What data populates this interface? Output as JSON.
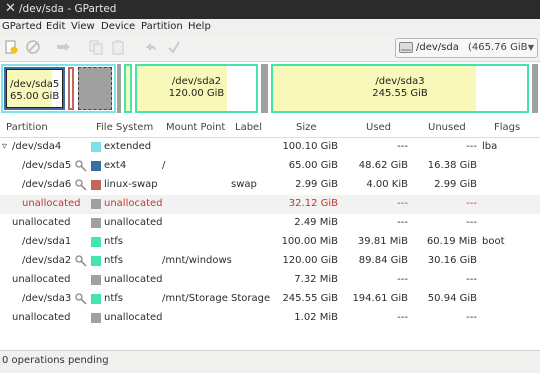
{
  "window": {
    "title": "/dev/sda - GParted",
    "close_glyph": "✕"
  },
  "menu": [
    "GParted",
    "Edit",
    "View",
    "Device",
    "Partition",
    "Help"
  ],
  "toolbar": {
    "icons": [
      "new-partition-icon",
      "delete-icon",
      "resize-move-icon",
      "copy-icon",
      "paste-icon",
      "undo-icon",
      "apply-icon"
    ]
  },
  "device": {
    "name": "/dev/sda",
    "size": "(465.76 GiB",
    "arrow": "▼"
  },
  "disk_map": {
    "sda5": {
      "name": "/dev/sda5",
      "size": "65.00 GiB"
    },
    "sda2": {
      "name": "/dev/sda2",
      "size": "120.00 GiB"
    },
    "sda3": {
      "name": "/dev/sda3",
      "size": "245.55 GiB"
    }
  },
  "columns": [
    "Partition",
    "File System",
    "Mount Point",
    "Label",
    "Size",
    "Used",
    "Unused",
    "Flags"
  ],
  "rows": [
    {
      "partition": "/dev/sda4",
      "fs": "extended",
      "mount": "",
      "label": "",
      "size": "100.10 GiB",
      "used": "---",
      "unused": "---",
      "flags": "lba"
    },
    {
      "partition": "/dev/sda5",
      "fs": "ext4",
      "mount": "/",
      "label": "",
      "size": "65.00 GiB",
      "used": "48.62 GiB",
      "unused": "16.38 GiB",
      "flags": ""
    },
    {
      "partition": "/dev/sda6",
      "fs": "linux-swap",
      "mount": "",
      "label": "swap",
      "size": "2.99 GiB",
      "used": "4.00 KiB",
      "unused": "2.99 GiB",
      "flags": ""
    },
    {
      "partition": "unallocated",
      "fs": "unallocated",
      "mount": "",
      "label": "",
      "size": "32.12 GiB",
      "used": "---",
      "unused": "---",
      "flags": ""
    },
    {
      "partition": "unallocated",
      "fs": "unallocated",
      "mount": "",
      "label": "",
      "size": "2.49 MiB",
      "used": "---",
      "unused": "---",
      "flags": ""
    },
    {
      "partition": "/dev/sda1",
      "fs": "ntfs",
      "mount": "",
      "label": "",
      "size": "100.00 MiB",
      "used": "39.81 MiB",
      "unused": "60.19 MiB",
      "flags": "boot"
    },
    {
      "partition": "/dev/sda2",
      "fs": "ntfs",
      "mount": "/mnt/windows",
      "label": "",
      "size": "120.00 GiB",
      "used": "89.84 GiB",
      "unused": "30.16 GiB",
      "flags": ""
    },
    {
      "partition": "unallocated",
      "fs": "unallocated",
      "mount": "",
      "label": "",
      "size": "7.32 MiB",
      "used": "---",
      "unused": "---",
      "flags": ""
    },
    {
      "partition": "/dev/sda3",
      "fs": "ntfs",
      "mount": "/mnt/Storage",
      "label": "Storage",
      "size": "245.55 GiB",
      "used": "194.61 GiB",
      "unused": "50.94 GiB",
      "flags": ""
    },
    {
      "partition": "unallocated",
      "fs": "unallocated",
      "mount": "",
      "label": "",
      "size": "1.02 MiB",
      "used": "---",
      "unused": "---",
      "flags": ""
    }
  ],
  "tree_toggle": "▿",
  "colors": {
    "extended": "#7fe0e8",
    "ext4": "#3a6ea5",
    "linux-swap": "#c1665a",
    "ntfs": "#42e5ac",
    "unallocated": "#a0a0a0",
    "used_fill": "#f8f8bb",
    "highlight_text": "#c0392b",
    "selection_bg": "#f2f2f2"
  },
  "status": {
    "text": "0 operations pending"
  }
}
